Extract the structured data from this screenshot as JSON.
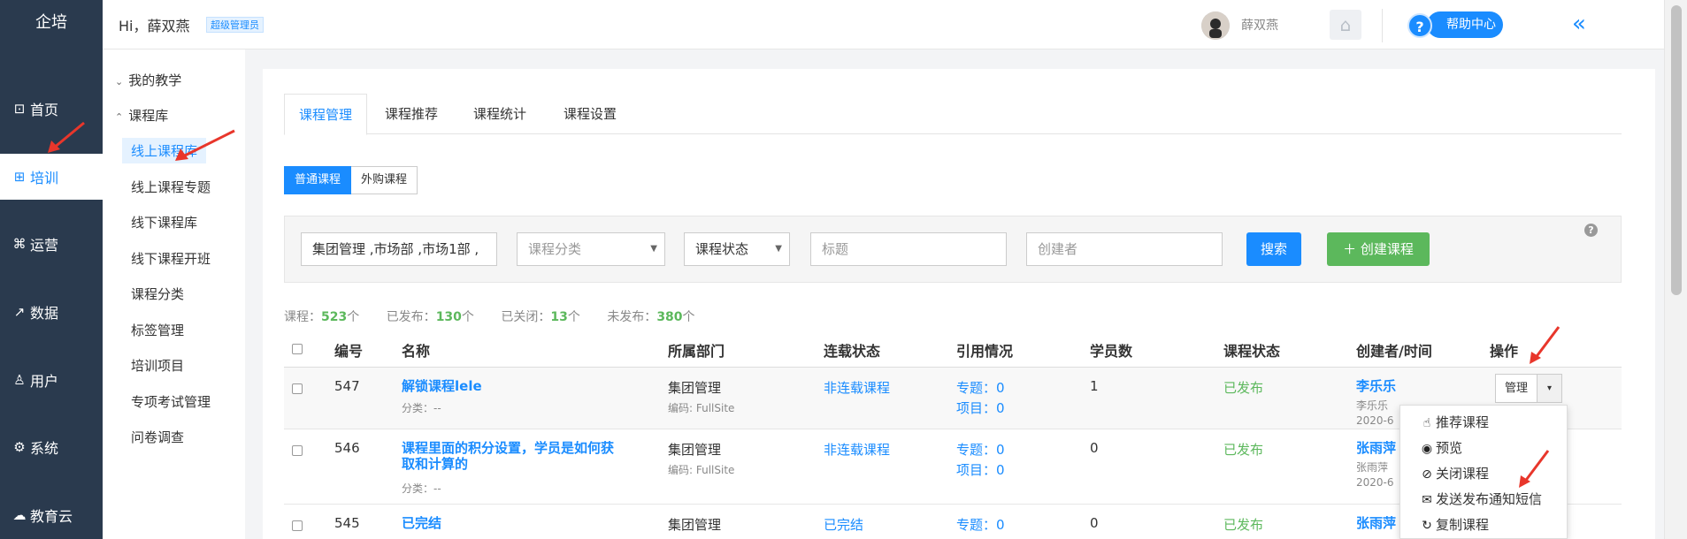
{
  "brand": "企培",
  "left_nav": [
    {
      "label": "首页",
      "icon": "dashboard-icon"
    },
    {
      "label": "培训",
      "icon": "book-icon"
    },
    {
      "label": "运营",
      "icon": "command-icon"
    },
    {
      "label": "数据",
      "icon": "chart-icon"
    },
    {
      "label": "用户",
      "icon": "user-icon"
    },
    {
      "label": "系统",
      "icon": "gear-icon"
    },
    {
      "label": "教育云",
      "icon": "cloud-icon"
    }
  ],
  "header": {
    "greeting": "Hi，薛双燕",
    "role_badge": "超级管理员",
    "username": "薛双燕",
    "help_label": "帮助中心",
    "help_q": "?"
  },
  "sub_nav": {
    "group_my": "我的教学",
    "group_lib": "课程库",
    "items": [
      "线上课程库",
      "线上课程专题",
      "线下课程库",
      "线下课程开班",
      "课程分类",
      "标签管理",
      "培训项目",
      "专项考试管理",
      "问卷调查"
    ]
  },
  "tabs": [
    "课程管理",
    "课程推荐",
    "课程统计",
    "课程设置"
  ],
  "type_toggle": [
    "普通课程",
    "外购课程"
  ],
  "filters": {
    "department_value": "集团管理 ,市场部 ,市场1部 ,",
    "category_placeholder": "课程分类",
    "status_placeholder": "课程状态",
    "title_placeholder": "标题",
    "creator_placeholder": "创建者",
    "search_label": "搜索",
    "create_label": "创建课程"
  },
  "stats": [
    {
      "label": "课程：",
      "value": "523",
      "unit": "个"
    },
    {
      "label": "已发布：",
      "value": "130",
      "unit": "个"
    },
    {
      "label": "已关闭：",
      "value": "13",
      "unit": "个"
    },
    {
      "label": "未发布：",
      "value": "380",
      "unit": "个"
    }
  ],
  "table": {
    "headers": [
      "编号",
      "名称",
      "所属部门",
      "连载状态",
      "引用情况",
      "学员数",
      "课程状态",
      "创建者/时间",
      "操作"
    ],
    "rows": [
      {
        "id": "547",
        "name": "解锁课程lele",
        "category": "分类：--",
        "dept": "集团管理",
        "dept_code": "编码: FullSite",
        "serial": "非连载课程",
        "ref_topic": "专题：0",
        "ref_project": "项目：0",
        "students": "1",
        "status": "已发布",
        "creator": "李乐乐",
        "creator_sub": "李乐乐",
        "date": "2020-6"
      },
      {
        "id": "546",
        "name": "课程里面的积分设置，学员是如何获取和计算的",
        "category": "分类：--",
        "dept": "集团管理",
        "dept_code": "编码: FullSite",
        "serial": "非连载课程",
        "ref_topic": "专题：0",
        "ref_project": "项目：0",
        "students": "0",
        "status": "已发布",
        "creator": "张雨萍",
        "creator_sub": "张雨萍",
        "date": "2020-6"
      },
      {
        "id": "545",
        "name": "已完结",
        "category": "",
        "dept": "集团管理",
        "dept_code": "",
        "serial": "已完结",
        "ref_topic": "专题：0",
        "ref_project": "",
        "students": "0",
        "status": "已发布",
        "creator": "张雨萍",
        "creator_sub": "",
        "date": ""
      }
    ]
  },
  "row_actions": {
    "manage_label": "管理",
    "caret": "▾"
  },
  "dropdown_menu": [
    "推荐课程",
    "预览",
    "关闭课程",
    "发送发布通知短信",
    "复制课程"
  ],
  "colors": {
    "primary": "#1a8cff",
    "sidebar": "#2a3a4e",
    "success": "#5cb85c",
    "arrow": "#e8362b"
  }
}
